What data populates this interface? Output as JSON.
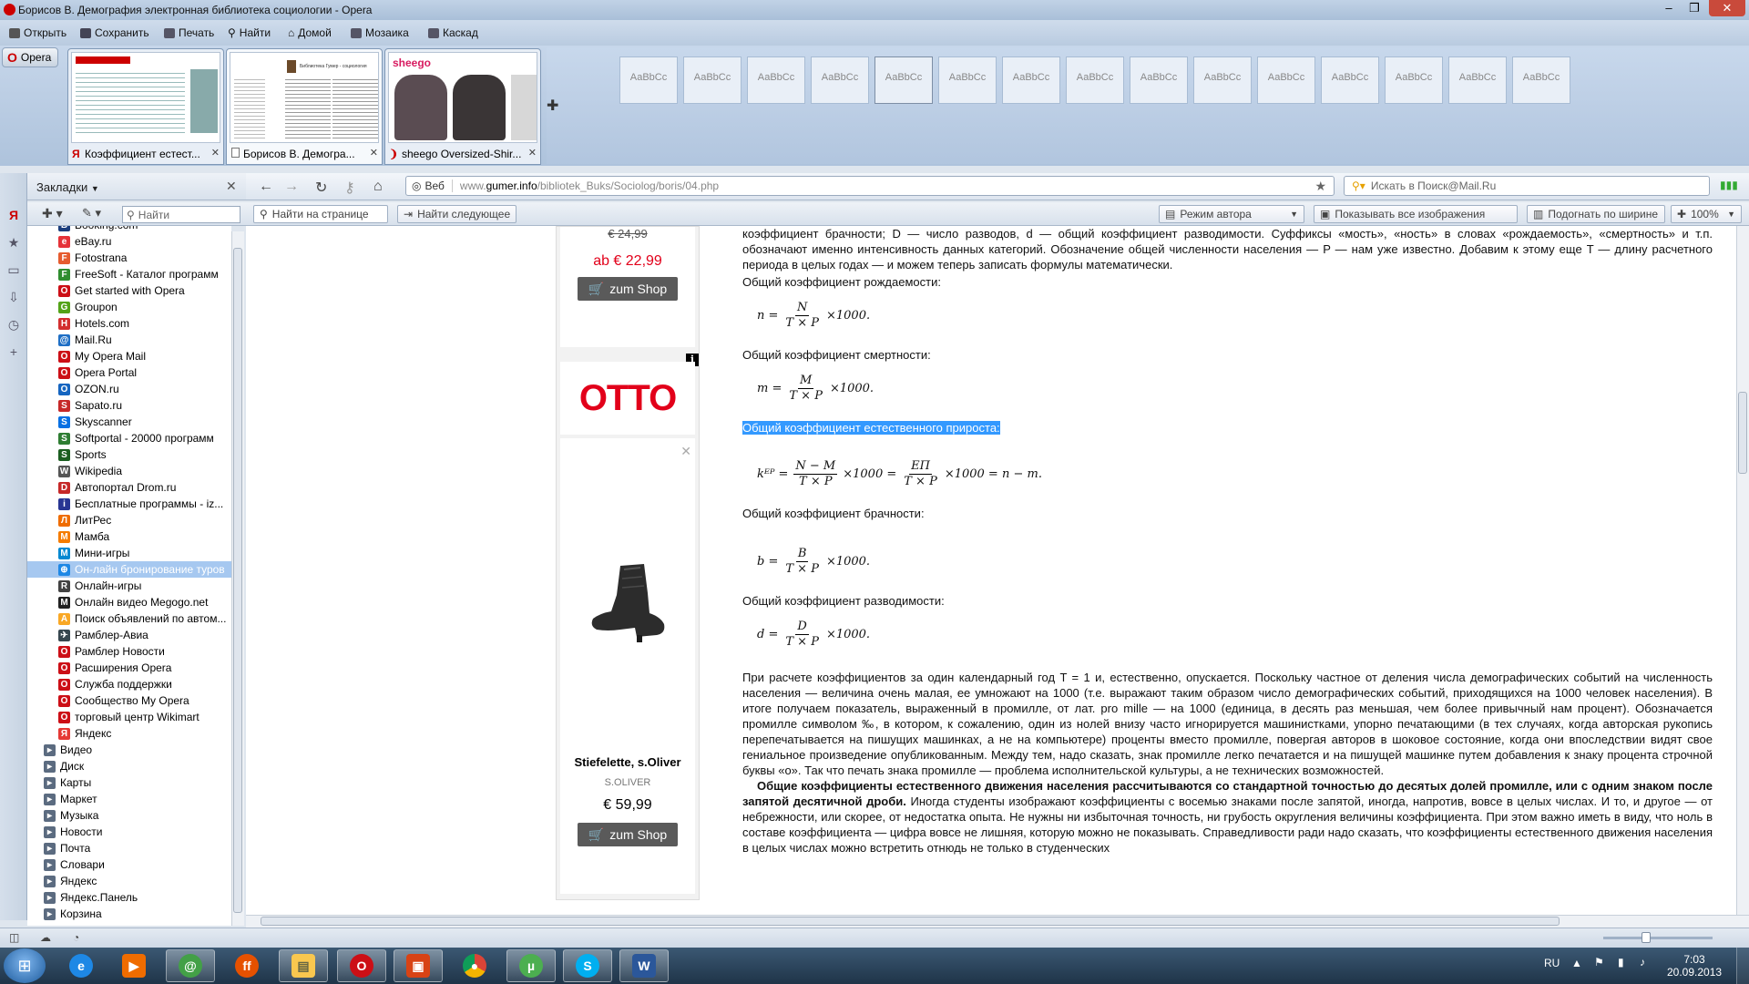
{
  "window": {
    "title": "Борисов В. Демография электронная библиотека социологии - Opera",
    "controls": [
      "–",
      "❐",
      "✕"
    ]
  },
  "toolbar": {
    "items": [
      "Открыть",
      "Сохранить",
      "Печать",
      "Найти",
      "Домой",
      "Мозаика",
      "Каскад"
    ]
  },
  "menu": {
    "label": "Opera"
  },
  "tabs": [
    {
      "label": "Коэффициент естест...",
      "active": false
    },
    {
      "label": "Борисов В. Демогра...",
      "active": true
    },
    {
      "label": "sheego Oversized-Shir...",
      "active": false
    }
  ],
  "tab_thumb_texts": {
    "tab2_site": "Библиотека Гумер - социология",
    "tab2_title": "Борисов В. Демография",
    "tab3_brand": "sheego"
  },
  "ribbon_styles": [
    "АаВbСс",
    "АаВbСс",
    "АаВbСс",
    "АаВbСс",
    "АаВbСс",
    "АаВbСс",
    "АаВbСс",
    "АаВbСс",
    "АаВbСс",
    "АаВbСс",
    "АаВbСс",
    "АаВbСс",
    "АаВbСс",
    "АаВbСс",
    "АаВbСс"
  ],
  "address": {
    "web_label": "Веб",
    "url_prefix": "www.",
    "url_domain": "gumer.info",
    "url_path": "/bibliotek_Buks/Sociolog/boris/04.php"
  },
  "search": {
    "placeholder": "Искать в Поиск@Mail.Ru"
  },
  "findbar": {
    "find_on_page": "Найти на странице",
    "find_next": "Найти следующее",
    "author_mode": "Режим автора",
    "show_images": "Показывать все изображения",
    "fit_width": "Подогнать по ширине",
    "zoom": "100%"
  },
  "bookmarks_panel": {
    "title": "Закладки",
    "find_placeholder": "Найти",
    "items": [
      {
        "label": "Booking.com",
        "color": "#1a3d7c",
        "glyph": "B"
      },
      {
        "label": "eBay.ru",
        "color": "#e53238",
        "glyph": "e"
      },
      {
        "label": "Fotostrana",
        "color": "#e65c2f",
        "glyph": "F"
      },
      {
        "label": "FreeSoft - Каталог программ",
        "color": "#2f8d2f",
        "glyph": "F"
      },
      {
        "label": "Get started with Opera",
        "color": "#cc0f16",
        "glyph": "O"
      },
      {
        "label": "Groupon",
        "color": "#53a318",
        "glyph": "G"
      },
      {
        "label": "Hotels.com",
        "color": "#d32f2f",
        "glyph": "H"
      },
      {
        "label": "Mail.Ru",
        "color": "#1f6fc5",
        "glyph": "@"
      },
      {
        "label": "My Opera Mail",
        "color": "#cc0f16",
        "glyph": "O"
      },
      {
        "label": "Opera Portal",
        "color": "#cc0f16",
        "glyph": "O"
      },
      {
        "label": "OZON.ru",
        "color": "#1565c0",
        "glyph": "O"
      },
      {
        "label": "Sapato.ru",
        "color": "#c62828",
        "glyph": "S"
      },
      {
        "label": "Skyscanner",
        "color": "#0770e3",
        "glyph": "S"
      },
      {
        "label": "Softportal - 20000 программ",
        "color": "#2e7d32",
        "glyph": "S"
      },
      {
        "label": "Sports",
        "color": "#1b5e20",
        "glyph": "S"
      },
      {
        "label": "Wikipedia",
        "color": "#555555",
        "glyph": "W"
      },
      {
        "label": "Автопортал Drom.ru",
        "color": "#c62828",
        "glyph": "D"
      },
      {
        "label": "Бесплатные программы - iz...",
        "color": "#283593",
        "glyph": "i"
      },
      {
        "label": "ЛитРес",
        "color": "#ef6c00",
        "glyph": "Л"
      },
      {
        "label": "Мамба",
        "color": "#f57c00",
        "glyph": "M"
      },
      {
        "label": "Мини-игры",
        "color": "#0288d1",
        "glyph": "M"
      },
      {
        "label": "Он-лайн бронирование туров",
        "color": "#1e88e5",
        "glyph": "⊕",
        "selected": true
      },
      {
        "label": "Онлайн-игры",
        "color": "#424242",
        "glyph": "R"
      },
      {
        "label": "Онлайн видео Megogo.net",
        "color": "#212121",
        "glyph": "M"
      },
      {
        "label": "Поиск объявлений по автом...",
        "color": "#f9a825",
        "glyph": "A"
      },
      {
        "label": "Рамблер-Авиа",
        "color": "#37474f",
        "glyph": "✈"
      },
      {
        "label": "Рамблер Новости",
        "color": "#cc0f16",
        "glyph": "O"
      },
      {
        "label": "Расширения Opera",
        "color": "#cc0f16",
        "glyph": "O"
      },
      {
        "label": "Служба поддержки",
        "color": "#cc0f16",
        "glyph": "O"
      },
      {
        "label": "Сообщество My Opera",
        "color": "#cc0f16",
        "glyph": "O"
      },
      {
        "label": "торговый центр Wikimart",
        "color": "#cc0f16",
        "glyph": "O"
      },
      {
        "label": "Яндекс",
        "color": "#e53935",
        "glyph": "Я"
      }
    ],
    "folders": [
      "Видео",
      "Диск",
      "Карты",
      "Маркет",
      "Музыка",
      "Новости",
      "Почта",
      "Словари",
      "Яндекс",
      "Яндекс.Панель",
      "Корзина"
    ]
  },
  "ad": {
    "price_old": "€ 24,99",
    "price1": "ab € 22,99",
    "shop_btn": "zum Shop",
    "brand": "OTTO",
    "product_name": "Stiefelette, s.Oliver",
    "product_brand": "S.OLIVER",
    "price2": "€ 59,99",
    "info": "i",
    "close": "✕"
  },
  "article": {
    "intro": "коэффициент брачности; D — число разводов, d — общий коэффициент разводимости. Суффиксы «мость», «ность» в словах «рождаемость», «смертность» и т.п. обозначают именно интенсивность данных категорий. Обозначение общей численности населения — P — нам уже известно. Добавим к этому еще T — длину расчетного периода в целых годах — и можем теперь записать формулы математически.",
    "h_birth": "Общий коэффициент рождаемости:",
    "h_death": "Общий коэффициент смертности:",
    "h_natural": "Общий коэффициент естественного прироста:",
    "h_marriage": "Общий коэффициент брачности:",
    "h_divorce": "Общий коэффициент разводимости:",
    "f_birth": {
      "lhs": "n =",
      "num": "N",
      "den": "T × P",
      "tail": "×1000."
    },
    "f_death": {
      "lhs": "m =",
      "num": "M",
      "den": "T × P",
      "tail": "×1000."
    },
    "f_nat": {
      "lhs": "kᴱᴾ =",
      "num1": "N − M",
      "den1": "T × P",
      "mid": "×1000 =",
      "num2": "ЕП",
      "den2": "T × P",
      "tail": "×1000 = n − m."
    },
    "f_marriage": {
      "lhs": "b =",
      "num": "B",
      "den": "T × P",
      "tail": "×1000."
    },
    "f_divorce": {
      "lhs": "d =",
      "num": "D",
      "den": "T × P",
      "tail": "×1000."
    },
    "p1": "При расчете коэффициентов за один календарный год T = 1 и, естественно, опускается. Поскольку частное от деления числа демографических событий на численность населения — величина очень малая, ее умножают на 1000 (т.е. выражают таким образом число демографических событий, приходящихся на 1000 человек населения). В итоге получаем показатель, выраженный в промилле, от лат. pro mille — на 1000 (единица, в десять раз меньшая, чем более привычный нам процент). Обозначается промилле символом ‰, в котором, к сожалению, один из нолей внизу часто игнорируется машинистками, упорно печатающими (в тех случаях, когда авторская рукопись перепечатывается на пишущих машинках, а не на компьютере) проценты вместо промилле, повергая авторов в шоковое состояние, когда они впоследствии видят свое гениальное произведение опубликованным. Между тем, надо сказать, знак промилле легко печатается и на пишущей машинке путем добавления к знаку процента строчной буквы «о». Так что печать знака промилле — проблема исполнительской культуры, а не технических возможностей.",
    "p2_bold": "Общие коэффициенты естественного движения населения рассчитываются со стандартной точностью до десятых долей промилле, или с одним знаком после запятой десятичной дроби.",
    "p2_rest": " Иногда студенты изображают коэффициенты с восемью знаками после запятой, иногда, напротив, вовсе в целых числах. И то, и другое — от небрежности, или скорее, от недостатка опыта. Не нужны ни избыточная точность, ни грубость округления величины коэффициента. При этом важно иметь в виду, что ноль в составе коэффициента — цифра вовсе не лишняя, которую можно не показывать. Справедливости ради надо сказать, что коэффициенты естественного движения населения в целых числах можно встретить отнюдь не только в студенческих"
  },
  "taskbar": {
    "lang": "RU",
    "time": "7:03",
    "date": "20.09.2013"
  },
  "colors": {
    "accent": "#3399ff",
    "opera_red": "#cc0f16",
    "otto_red": "#e2001a"
  }
}
